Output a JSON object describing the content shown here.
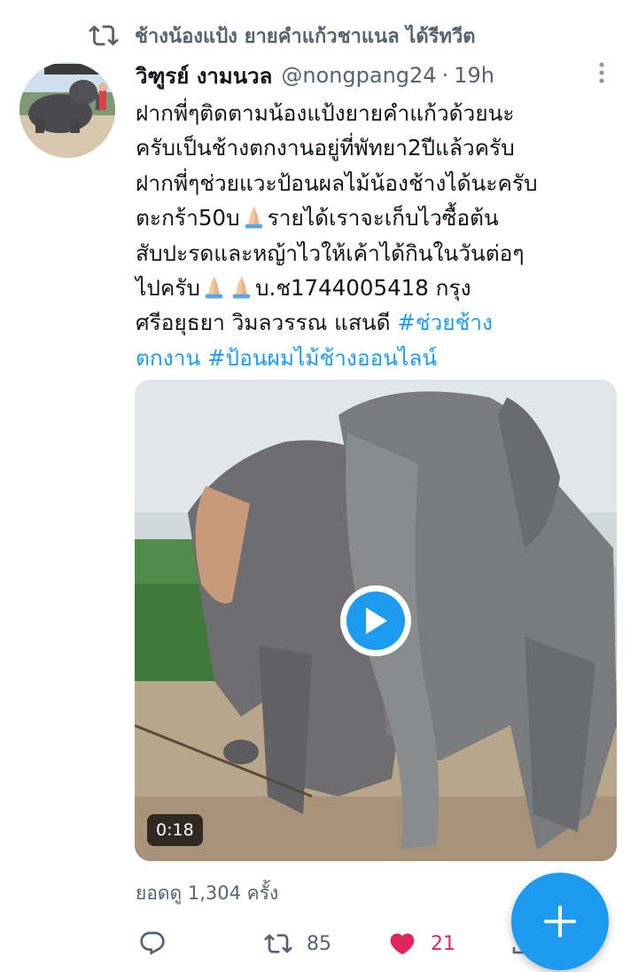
{
  "retweet_header": {
    "icon": "retweet-icon",
    "text": "ช้างน้องแป้ง ยายคำแก้วชาแนล ได้รีทวีต"
  },
  "tweet": {
    "author": {
      "display_name": "วิฑูรย์ งามนวล",
      "handle": "@nongpang24",
      "separator": "·",
      "time": "19h"
    },
    "text": {
      "line1": "ฝากพี่ๆติดตามน้องแป้งยายคำแก้วด้วยนะ",
      "line2": "ครับเป็นช้างตกงานอยู่ที่พัทยา2ปีแล้วครับ",
      "line3": "ฝากพี่ๆช่วยแวะป้อนผลไม้น้องช้างได้นะครับ",
      "line4a": "ตะกร้า50บ",
      "line4b": "รายได้เราจะเก็บไวซื้อต้น",
      "line5": "สับปะรดและหญ้าไวให้เค้าได้กินในวันต่อๆ",
      "line6a": "ไปครับ",
      "line6b": "บ.ช1744005418 กรุง",
      "line7a": "ศรีอยุธยา วิมลวรรณ แสนดี ",
      "hashtag1_part1": "#ช่วยช้าง",
      "hashtag1_part2": "ตกงาน",
      "hashtag2": "#ป้อนผมไม้ช้างออนไลน์"
    },
    "media": {
      "type": "video",
      "duration": "0:18"
    },
    "views": "ยอดดู 1,304 ครั้ง",
    "actions": {
      "reply_count": "",
      "retweet_count": "85",
      "like_count": "21",
      "liked": true
    }
  },
  "colors": {
    "accent": "#1d9bf0",
    "like": "#e0245e",
    "secondary_text": "#536471"
  }
}
